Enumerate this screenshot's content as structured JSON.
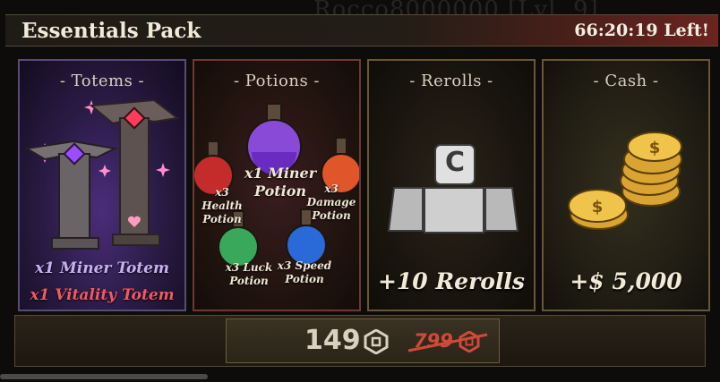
{
  "background_name": "Rocco8000000 [Lvl. 9]",
  "header": {
    "title": "Essentials Pack",
    "timer": "66:20:19 Left!"
  },
  "cards": [
    {
      "title": "- Totems -",
      "items": [
        "x1 Miner Totem",
        "x1 Vitality Totem"
      ]
    },
    {
      "title": "- Potions -",
      "center": [
        "x1 Miner",
        "Potion"
      ],
      "health": [
        "x3 Health",
        "Potion"
      ],
      "damage": [
        "x3 Damage",
        "Potion"
      ],
      "luck": [
        "x3 Luck",
        "Potion"
      ],
      "speed": [
        "x3 Speed",
        "Potion"
      ]
    },
    {
      "title": "- Rerolls -",
      "key_glyph": "C",
      "amount": "+10 Rerolls"
    },
    {
      "title": "- Cash -",
      "amount": "+$ 5,000"
    }
  ],
  "purchase": {
    "price": "149",
    "old_price": "799"
  },
  "colors": {
    "accent_gold": "#c9a15a",
    "totem_purple": "#c9b0f0",
    "totem_red": "#f05a60",
    "sale_red": "#d2493a"
  }
}
